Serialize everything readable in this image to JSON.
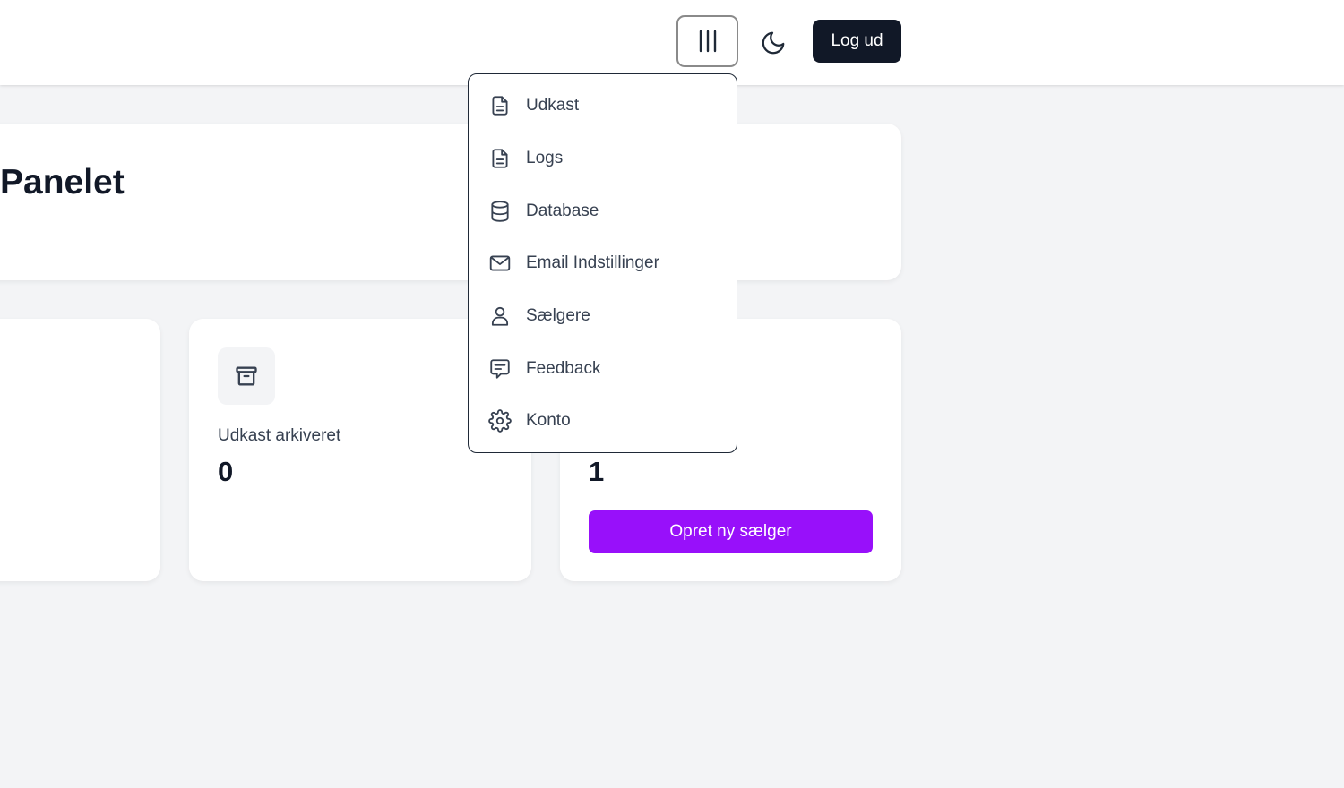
{
  "header": {
    "menu_toggle_icon": "vertical-bars-icon",
    "theme_toggle_icon": "moon-icon",
    "logout_label": "Log ud"
  },
  "welcome": {
    "title": "Panelet"
  },
  "stats": {
    "archived": {
      "icon": "archive-icon",
      "label": "Udkast arkiveret",
      "value": "0"
    },
    "sellers": {
      "value": "1",
      "button_label": "Opret ny sælger"
    }
  },
  "menu": {
    "items": [
      {
        "label": "Udkast",
        "icon": "document-icon"
      },
      {
        "label": "Logs",
        "icon": "document-icon"
      },
      {
        "label": "Database",
        "icon": "database-icon"
      },
      {
        "label": "Email Indstillinger",
        "icon": "mail-icon"
      },
      {
        "label": "Sælgere",
        "icon": "user-icon"
      },
      {
        "label": "Feedback",
        "icon": "message-icon"
      },
      {
        "label": "Konto",
        "icon": "gear-icon"
      }
    ]
  },
  "colors": {
    "accent": "#9810fa",
    "dark": "#111827",
    "background": "#f3f4f6"
  }
}
